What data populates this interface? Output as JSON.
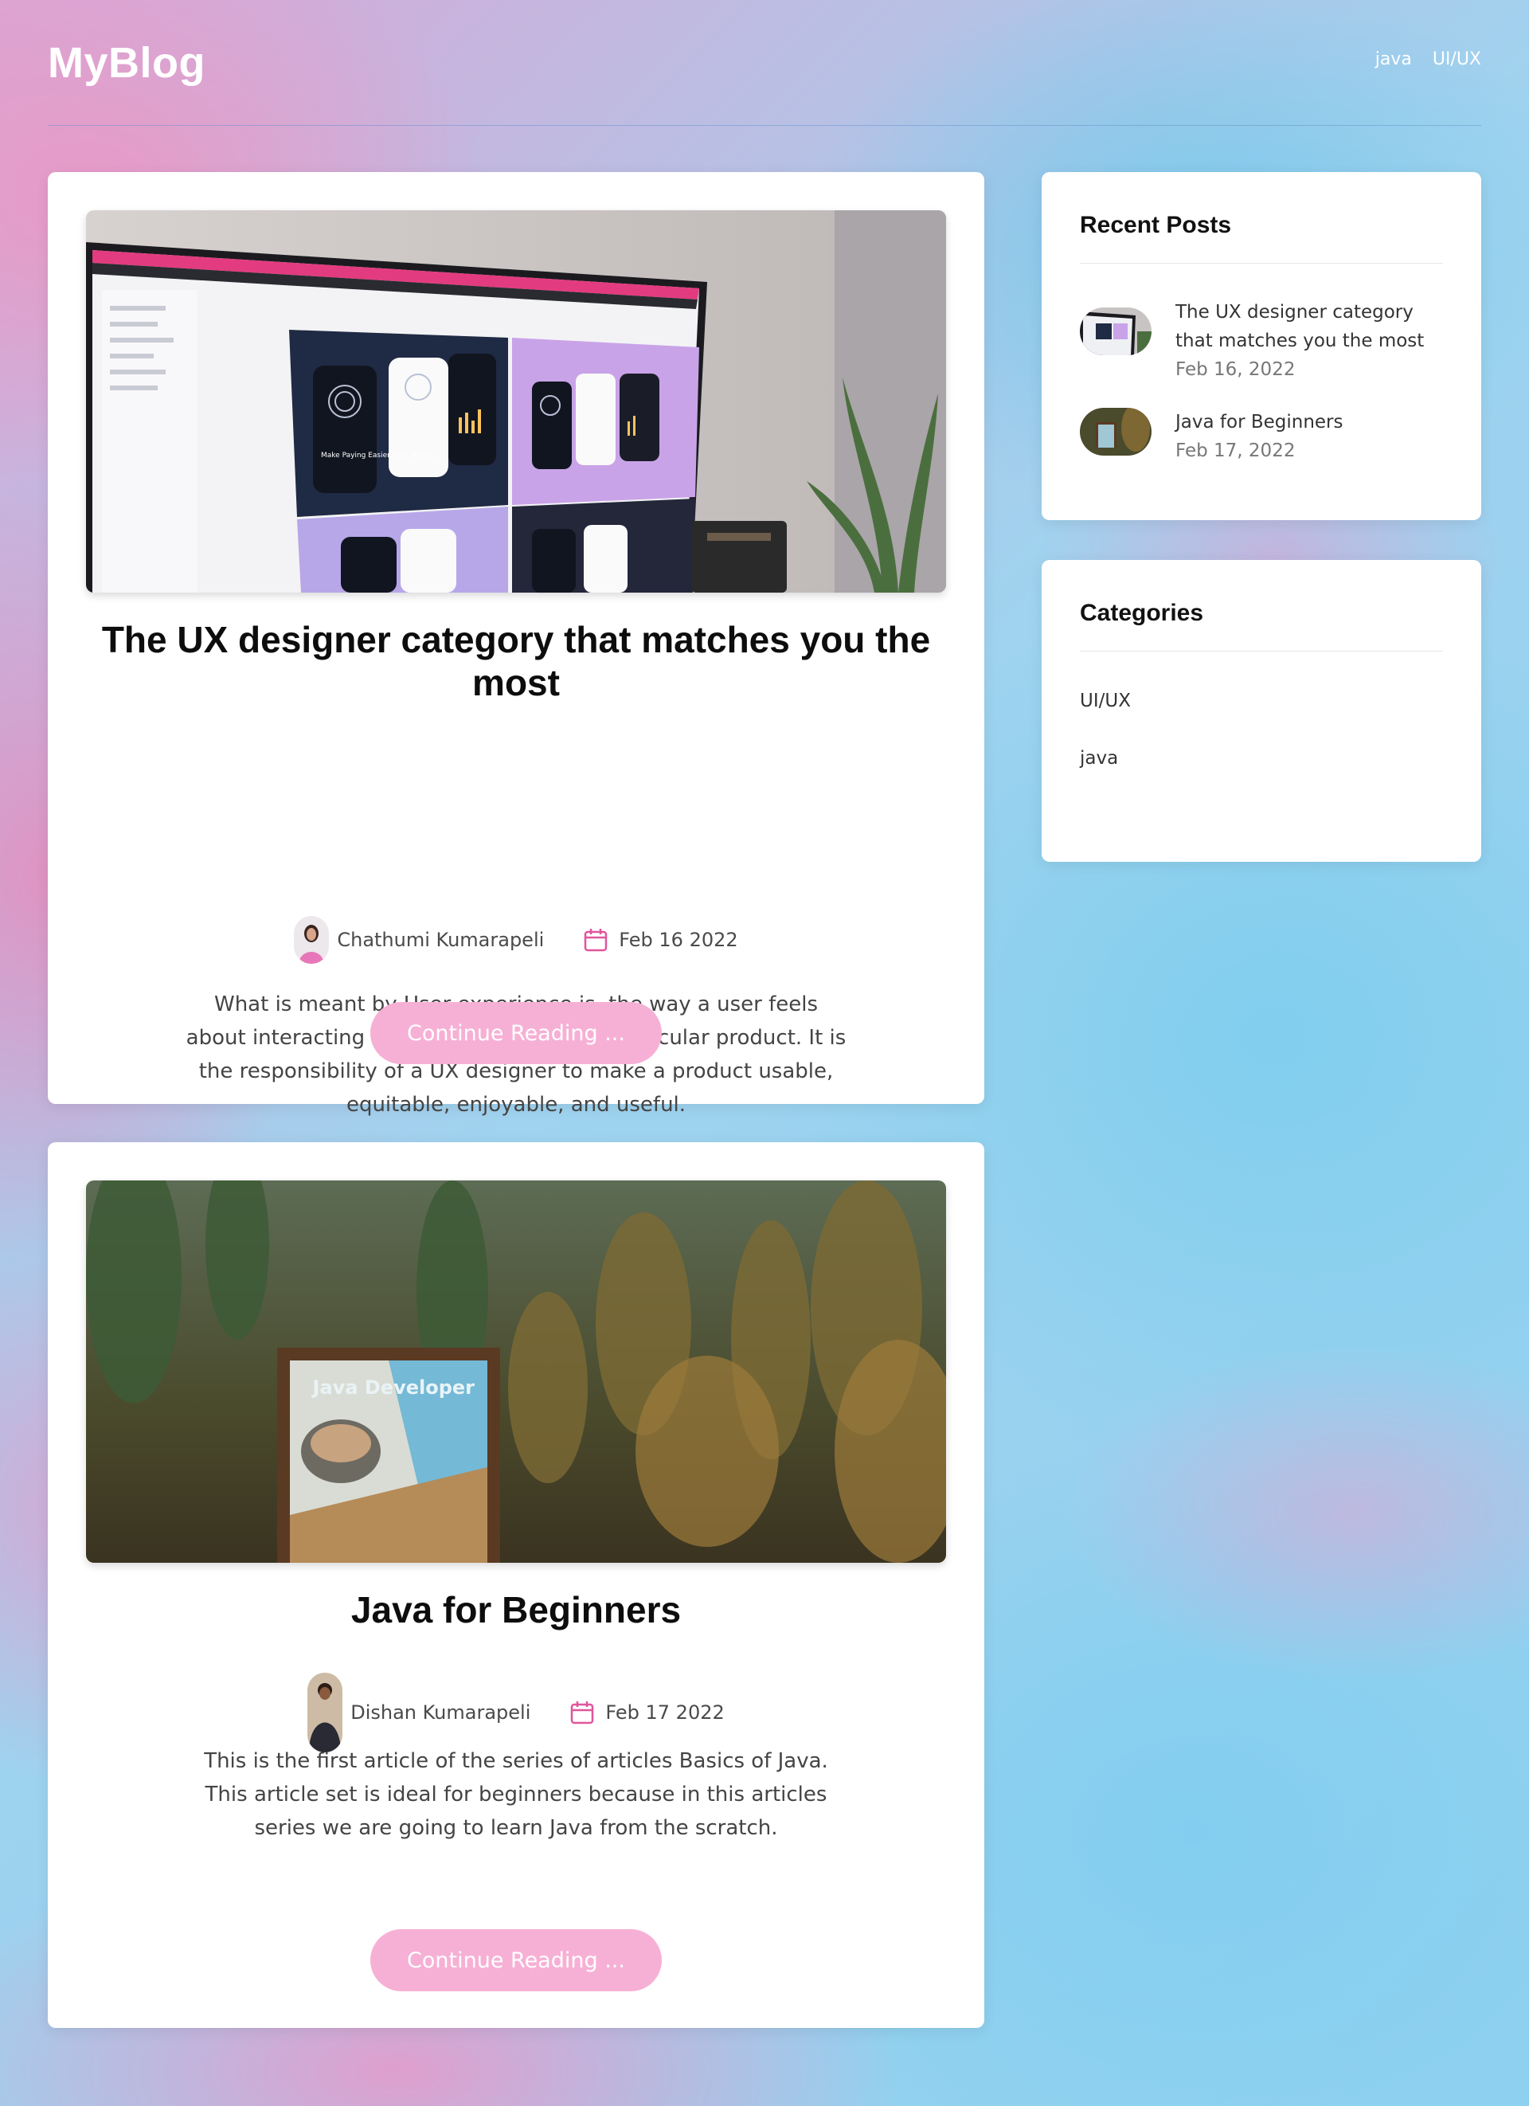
{
  "site": {
    "logo": "MyBlog",
    "nav": [
      "java",
      "UI/UX"
    ]
  },
  "posts": [
    {
      "title": "The UX designer category that matches you the most",
      "author": "Chathumi Kumarapeli",
      "date": "Feb 16 2022",
      "excerpt": "What is meant by User experience is, the way a user feels about interacting with or experiencing a particular product. It is the responsibility of a UX designer to make a product usable, equitable, enjoyable, and useful.",
      "button": "Continue Reading ..."
    },
    {
      "title": "Java for Beginners",
      "author": "Dishan Kumarapeli",
      "date": "Feb 17 2022",
      "excerpt": "This is the first article of the series of articles Basics of Java. This article set is ideal for beginners because in this articles series we are going to learn Java from the scratch.",
      "button": "Continue Reading ..."
    }
  ],
  "sidebar": {
    "recent_title": "Recent Posts",
    "recent": [
      {
        "title": "The UX designer category that matches you the most",
        "date": "Feb 16, 2022"
      },
      {
        "title": "Java for Beginners",
        "date": "Feb 17, 2022"
      }
    ],
    "categories_title": "Categories",
    "categories": [
      "UI/UX",
      "java"
    ]
  },
  "image_text": {
    "java_poster": "Java Developer",
    "ux_card": "Make Paying Easier With Wallet."
  },
  "colors": {
    "accent": "#e0559b",
    "button": "#f7b0d5"
  }
}
